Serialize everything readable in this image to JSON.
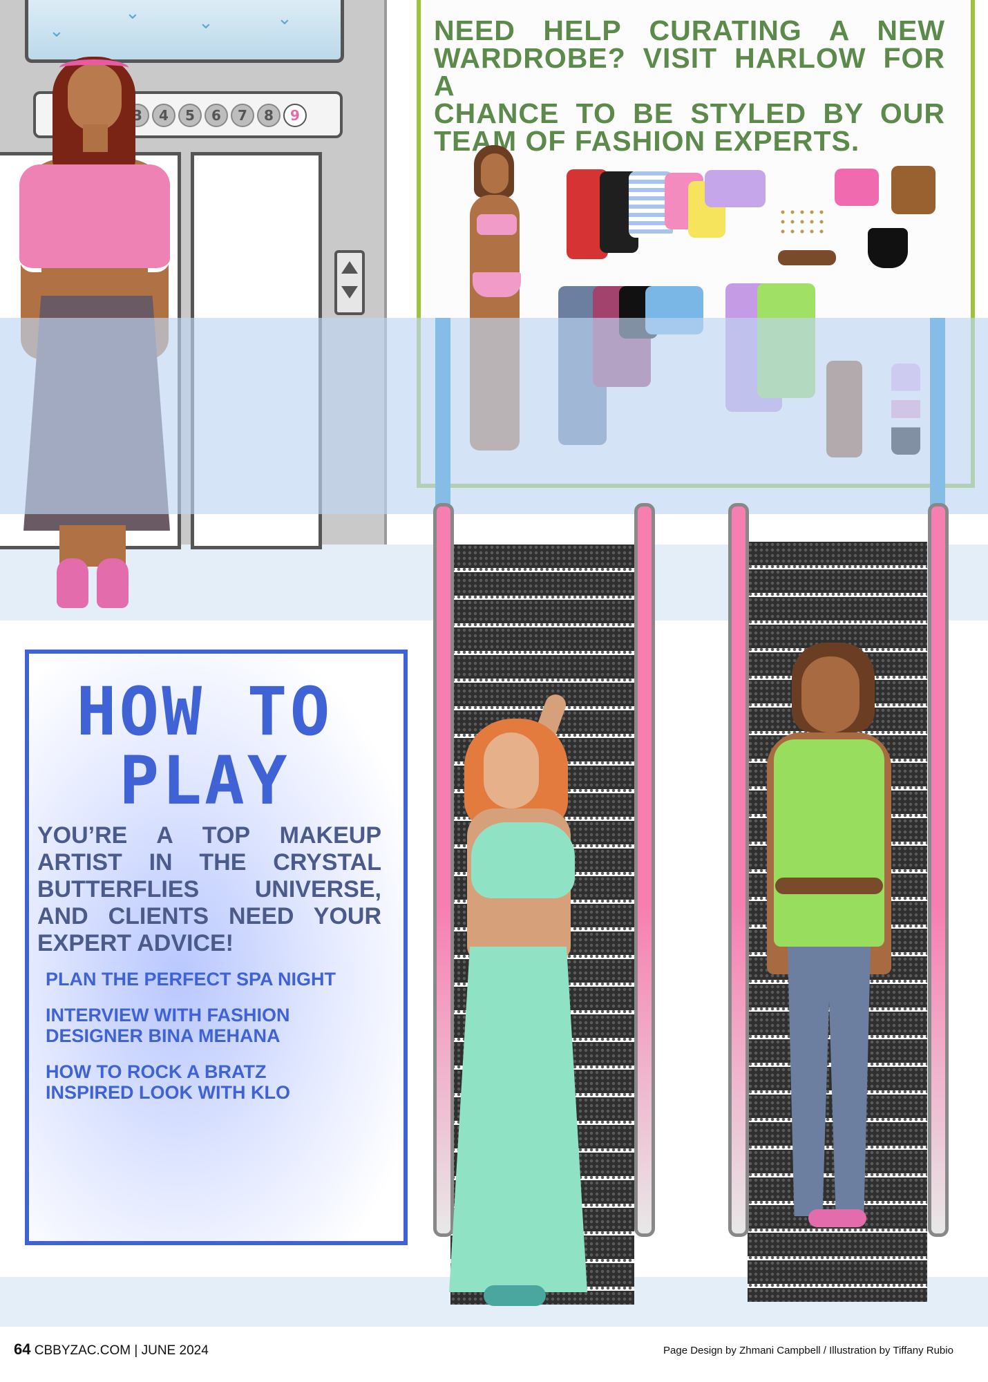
{
  "wardrobe": {
    "lines": [
      "NEED HELP CURATING A NEW",
      "WARDROBE? VISIT HARLOW FOR A",
      "CHANCE TO BE STYLED BY OUR",
      "TEAM OF FASHION EXPERTS."
    ]
  },
  "elevator": {
    "floors": [
      "3",
      "4",
      "5",
      "6",
      "7",
      "8",
      "9"
    ],
    "active_floor": "9",
    "icons": [
      "bird-icon",
      "up-arrow-icon",
      "down-arrow-icon"
    ]
  },
  "how_to_play": {
    "title_line1": "HOW TO",
    "title_line2": "PLAY",
    "body_lines": [
      "YOU’RE A TOP MAKEUP",
      "ARTIST IN THE CRYSTAL",
      "BUTTERFLIES UNIVERSE,",
      "AND CLIENTS NEED YOUR",
      "EXPERT ADVICE!"
    ],
    "items": [
      [
        "PLAN THE PERFECT SPA NIGHT"
      ],
      [
        "INTERVIEW WITH FASHION",
        "DESIGNER BINA MEHANA"
      ],
      [
        "HOW TO ROCK A BRATZ",
        "INSPIRED LOOK WITH KLO"
      ]
    ]
  },
  "footer": {
    "page_number": "64",
    "publication": "CBBYZAC.COM | JUNE 2024",
    "credits": "Page Design by Zhmani Campbell / Illustration by Tiffany Rubio"
  },
  "colors": {
    "wardrobe_text": "#5b8a4a",
    "wardrobe_border": "#9bc53d",
    "how_to_play_blue": "#3f63d4",
    "escalator_rail": "#f77fb0",
    "overlay_blue": "#bed6f2"
  }
}
